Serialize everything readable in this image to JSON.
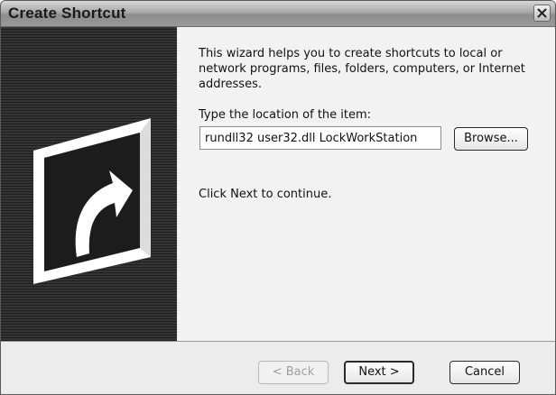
{
  "window": {
    "title": "Create Shortcut",
    "close_icon": "close-icon"
  },
  "side_panel": {
    "graphic_icon": "shortcut-arrow-icon"
  },
  "content": {
    "intro_text": "This wizard helps you to create shortcuts to local or network programs, files, folders, computers, or Internet addresses.",
    "location_label": "Type the location of the item:",
    "location_value": "rundll32 user32.dll LockWorkStation",
    "browse_label": "Browse...",
    "continue_text": "Click Next to continue."
  },
  "footer": {
    "back_label": "< Back",
    "back_enabled": false,
    "next_label": "Next >",
    "cancel_label": "Cancel"
  }
}
